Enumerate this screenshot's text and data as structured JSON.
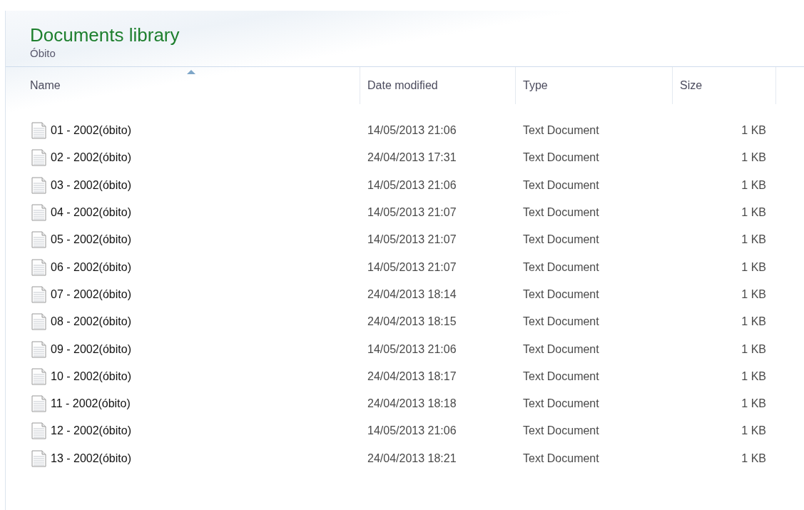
{
  "library": {
    "title": "Documents library",
    "subtitle": "Óbito"
  },
  "columns": [
    {
      "label": "Name",
      "sorted": true
    },
    {
      "label": "Date modified",
      "sorted": false
    },
    {
      "label": "Type",
      "sorted": false
    },
    {
      "label": "Size",
      "sorted": false
    }
  ],
  "files": [
    {
      "name": "01 - 2002(óbito)",
      "date": "14/05/2013 21:06",
      "type": "Text Document",
      "size": "1 KB"
    },
    {
      "name": "02 - 2002(óbito)",
      "date": "24/04/2013 17:31",
      "type": "Text Document",
      "size": "1 KB"
    },
    {
      "name": "03 - 2002(óbito)",
      "date": "14/05/2013 21:06",
      "type": "Text Document",
      "size": "1 KB"
    },
    {
      "name": "04 - 2002(óbito)",
      "date": "14/05/2013 21:07",
      "type": "Text Document",
      "size": "1 KB"
    },
    {
      "name": "05 - 2002(óbito)",
      "date": "14/05/2013 21:07",
      "type": "Text Document",
      "size": "1 KB"
    },
    {
      "name": "06 - 2002(óbito)",
      "date": "14/05/2013 21:07",
      "type": "Text Document",
      "size": "1 KB"
    },
    {
      "name": "07 - 2002(óbito)",
      "date": "24/04/2013 18:14",
      "type": "Text Document",
      "size": "1 KB"
    },
    {
      "name": "08 - 2002(óbito)",
      "date": "24/04/2013 18:15",
      "type": "Text Document",
      "size": "1 KB"
    },
    {
      "name": "09 - 2002(óbito)",
      "date": "14/05/2013 21:06",
      "type": "Text Document",
      "size": "1 KB"
    },
    {
      "name": "10 - 2002(óbito)",
      "date": "24/04/2013 18:17",
      "type": "Text Document",
      "size": "1 KB"
    },
    {
      "name": "11 - 2002(óbito)",
      "date": "24/04/2013 18:18",
      "type": "Text Document",
      "size": "1 KB"
    },
    {
      "name": "12 - 2002(óbito)",
      "date": "14/05/2013 21:06",
      "type": "Text Document",
      "size": "1 KB"
    },
    {
      "name": "13 - 2002(óbito)",
      "date": "24/04/2013 18:21",
      "type": "Text Document",
      "size": "1 KB"
    }
  ]
}
